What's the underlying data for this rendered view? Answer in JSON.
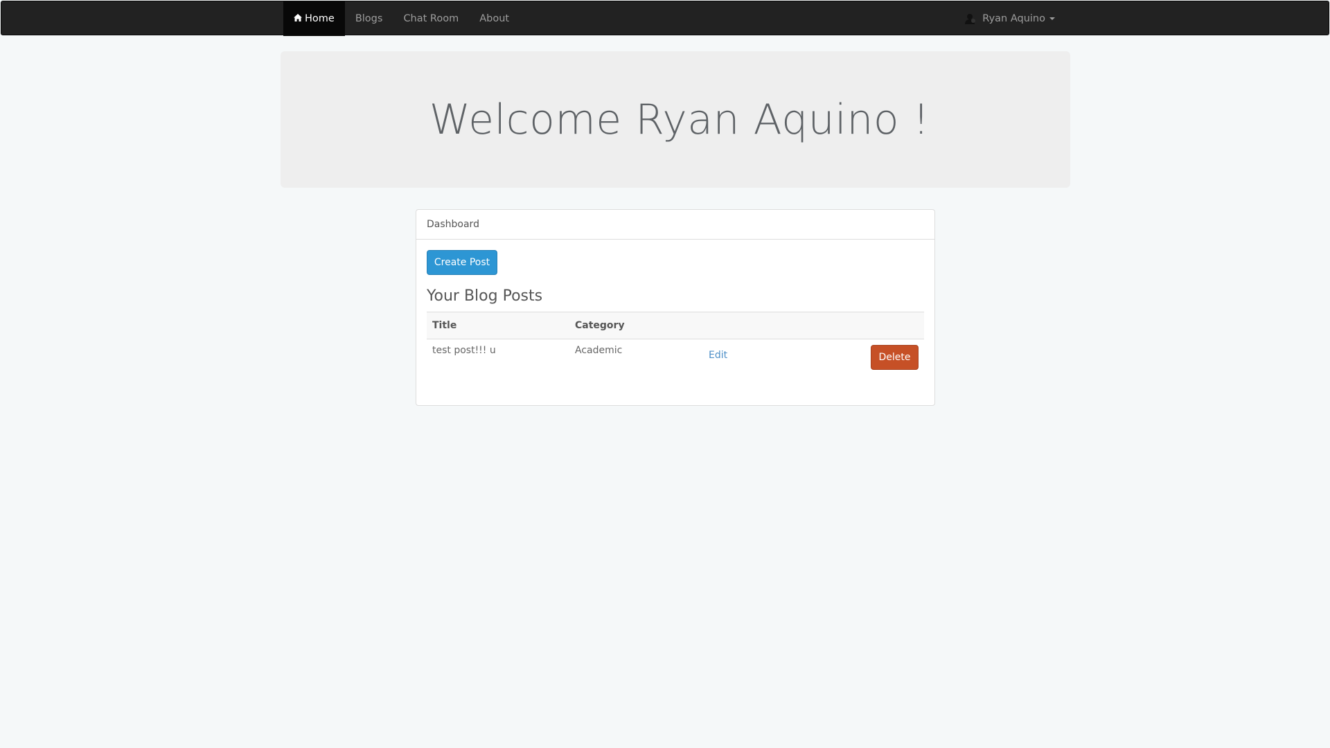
{
  "navbar": {
    "items": [
      {
        "label": "Home",
        "active": true,
        "icon": "home-icon"
      },
      {
        "label": "Blogs",
        "active": false
      },
      {
        "label": "Chat Room",
        "active": false
      },
      {
        "label": "About",
        "active": false
      }
    ],
    "user": {
      "name": "Ryan Aquino",
      "icon": "user-avatar-icon"
    }
  },
  "jumbotron": {
    "title": "Welcome Ryan Aquino !"
  },
  "panel": {
    "heading": "Dashboard",
    "create_button": "Create Post",
    "section_title": "Your Blog Posts",
    "table": {
      "columns": [
        "Title",
        "Category",
        "",
        ""
      ],
      "rows": [
        {
          "title": "test post!!! u",
          "category": "Academic",
          "edit_label": "Edit",
          "delete_label": "Delete"
        }
      ]
    }
  },
  "colors": {
    "navbar_bg": "#222222",
    "page_bg": "#f5f8f9",
    "primary": "#2d96d4",
    "danger": "#c65026",
    "link": "#4d8fc7"
  }
}
